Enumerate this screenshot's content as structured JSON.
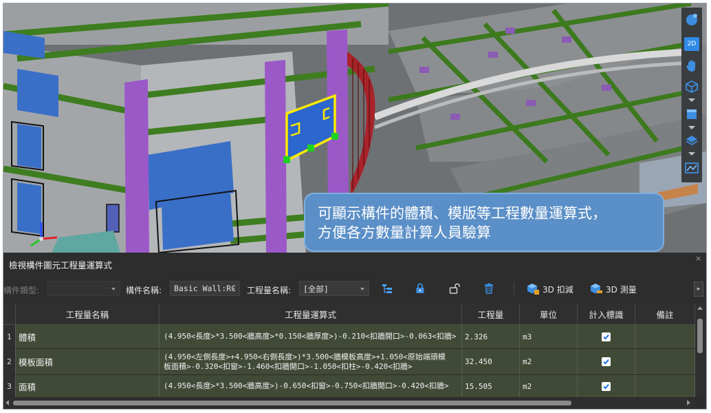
{
  "viewport": {
    "callout_lines": [
      "可顯示構件的體積、模版等工程數量運算式，",
      "方便各方數量計算人員驗算"
    ],
    "toolbar": [
      {
        "icon": "sphere-navigate-icon"
      },
      {
        "icon": "2d-view-icon",
        "label": "2D"
      },
      {
        "icon": "hand-pan-icon"
      },
      {
        "icon": "cube-view-icon"
      },
      {
        "icon": "solid-box-icon"
      },
      {
        "icon": "layers-icon"
      },
      {
        "icon": "section-box-icon"
      }
    ],
    "accent": "#2f8ae5"
  },
  "panel": {
    "title": "檢視構件圖元工程量運算式",
    "close": "×",
    "toolbar": {
      "component_type_label": "構件類型:",
      "component_type_value": "",
      "component_name_label": "構件名稱:",
      "component_name_value": "Basic Wall:RC",
      "quantity_name_label": "工程量名稱:",
      "quantity_name_value": "[全部]",
      "deduct_3d_label": "3D 扣減",
      "measure_3d_label": "3D 測量"
    },
    "table": {
      "headers": [
        "工程量名稱",
        "工程量運算式",
        "工程量",
        "單位",
        "計入標識",
        "備註"
      ],
      "rows": [
        {
          "index": "1",
          "name": "體積",
          "expr_lines": [
            "(4.950<長度>*3.500<牆高度>*0.150<牆厚度>)-0.210<扣牆開口>-0.063<扣牆>"
          ],
          "qty": "2.326",
          "unit": "m3",
          "counted": true,
          "note": ""
        },
        {
          "index": "2",
          "name": "模板面積",
          "expr_lines": [
            "(4.950<左側長度>+4.950<右側長度>)*3.500<牆模板高度>+1.050<原始端頭模",
            "板面積>-0.320<扣窗>-1.460<扣牆開口>-1.050<扣柱>-0.420<扣牆>"
          ],
          "qty": "32.450",
          "unit": "m2",
          "counted": true,
          "note": ""
        },
        {
          "index": "3",
          "name": "面積",
          "expr_lines": [
            "(4.950<長度>*3.500<牆高度>)-0.650<扣窗>-0.750<扣牆開口>-0.420<扣牆>"
          ],
          "qty": "15.505",
          "unit": "m2",
          "counted": true,
          "note": ""
        }
      ]
    }
  }
}
